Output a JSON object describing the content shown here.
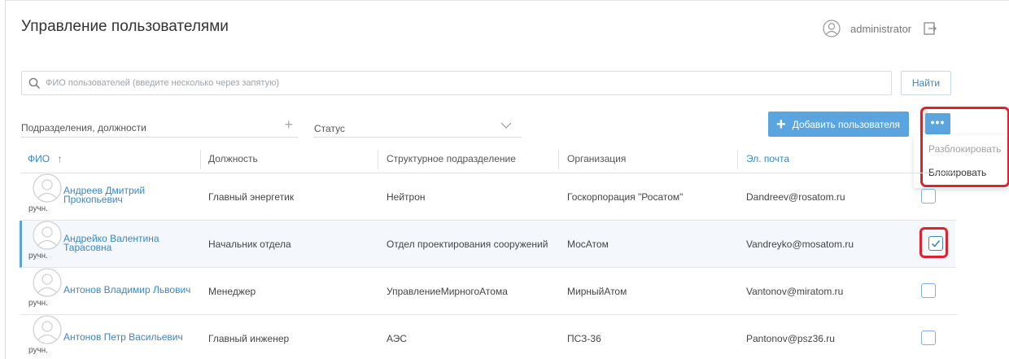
{
  "header": {
    "title": "Управление пользователями",
    "username": "administrator"
  },
  "search": {
    "placeholder": "ФИО пользователей (введите несколько через запятую)",
    "find_label": "Найти"
  },
  "filters": {
    "departments_label": "Подразделения, должности",
    "status_label": "Статус"
  },
  "actions": {
    "add_user_label": "Добавить пользователя",
    "more_label": "•••",
    "menu": {
      "unblock_label": "Разблокировать",
      "block_label": "Блокировать"
    }
  },
  "table": {
    "columns": {
      "name": "ФИО",
      "sort_indicator": "↑",
      "position": "Должность",
      "department": "Структурное подразделение",
      "organization": "Организация",
      "email": "Эл. почта"
    },
    "rows": [
      {
        "name_line1": "Андреев Дмитрий",
        "name_line2": "Прокопьевич",
        "source": "ручн.",
        "position": "Главный энергетик",
        "department": "Нейтрон",
        "organization": "Госкорпорация \"Росатом\"",
        "email": "Dandreev@rosatom.ru",
        "checked": false
      },
      {
        "name_line1": "Андрейко Валентина",
        "name_line2": "Тарасовна",
        "source": "ручн.",
        "position": "Начальник отдела",
        "department": "Отдел проектирования сооружений",
        "organization": "МосАтом",
        "email": "Vandreyko@mosatom.ru",
        "checked": true
      },
      {
        "name_line1": "Антонов Владимир Львович",
        "name_line2": "",
        "source": "ручн.",
        "position": "Менеджер",
        "department": "УправлениеМирногоАтома",
        "organization": "МирныйАтом",
        "email": "Vantonov@miratom.ru",
        "checked": false
      },
      {
        "name_line1": "Антонов Петр Васильевич",
        "name_line2": "",
        "source": "ручн.",
        "position": "Главный инженер",
        "department": "АЭС",
        "organization": "ПСЗ-36",
        "email": "Pantonov@psz36.ru",
        "checked": false
      }
    ]
  },
  "colors": {
    "accent": "#5aa5df",
    "link": "#3a86c8",
    "highlight": "#e0222c"
  }
}
